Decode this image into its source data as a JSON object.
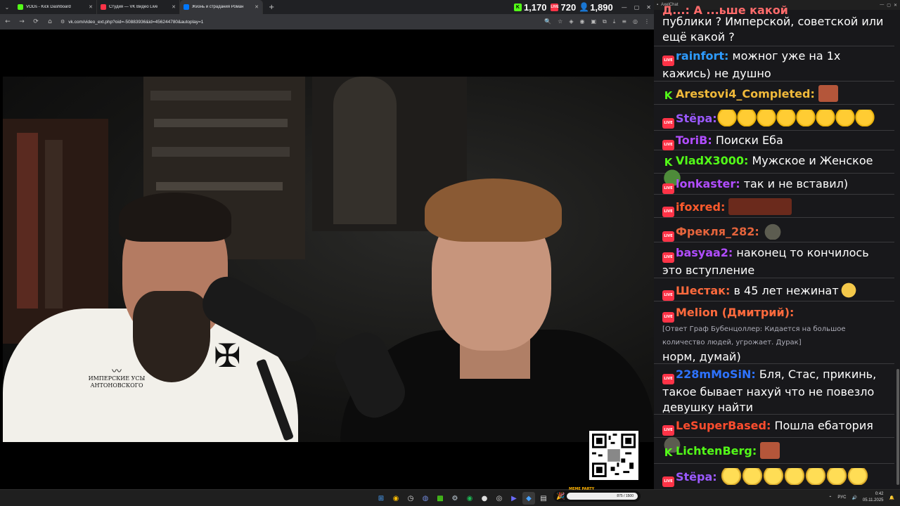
{
  "browser": {
    "tabs": [
      {
        "label": "VODs - Kick Dashboard",
        "favicon": "kick-icon"
      },
      {
        "label": "Студия — VK Видео Live",
        "favicon": "vk-live-icon"
      },
      {
        "label": "Жизнь и страдания Роман",
        "favicon": "vk-icon",
        "active": true
      }
    ],
    "url": "vk.com/video_ext.php?oid=-50883936&id=456244780&autoplay=1"
  },
  "counters": [
    {
      "platform": "kick",
      "value": "1,170",
      "color": "#53fc18"
    },
    {
      "platform": "vk-live",
      "value": "720",
      "color": "#ff3347"
    },
    {
      "platform": "viewers",
      "value": "1,890",
      "color": "#4aa3ff"
    }
  ],
  "video": {
    "shirt_logo_line1": "ИМПЕРСКИЕ УСЫ",
    "shirt_logo_line2": "АНТОНОВСКОГО"
  },
  "chat": {
    "window_title": "AxelChat",
    "messages": [
      {
        "platform": "live",
        "user": "",
        "color": "#ff6b6b",
        "text": "публики ? Имперской, советской или ещё какой ?"
      },
      {
        "platform": "live",
        "user": "rainfort:",
        "color": "#2e9cff",
        "text": "можног уже на 1х кажись) не душно"
      },
      {
        "platform": "kick",
        "user": "Arestovi4_Completed:",
        "color": "#f0b93a",
        "text": ""
      },
      {
        "platform": "live",
        "user": "Stёра:",
        "color": "#9b59ff",
        "text": ""
      },
      {
        "platform": "live",
        "user": "ToriB:",
        "color": "#b14dff",
        "text": "Поиски Еба"
      },
      {
        "platform": "kick",
        "user": "VladX3000:",
        "color": "#53fc18",
        "text": "Мужское и Женское"
      },
      {
        "platform": "live",
        "user": "lonkaster:",
        "color": "#b14dff",
        "text": "так и не вставил)"
      },
      {
        "platform": "live",
        "user": "ifoxred:",
        "color": "#ff5a2c",
        "text": ""
      },
      {
        "platform": "live",
        "user": "Фрекля_282:",
        "color": "#e5643c",
        "text": ""
      },
      {
        "platform": "live",
        "user": "basyaa2:",
        "color": "#b14dff",
        "text": "наконец то кончилось это вступление"
      },
      {
        "platform": "live",
        "user": "Шестак:",
        "color": "#ff6a3d",
        "text": "в 45 лет нежинат"
      },
      {
        "platform": "live",
        "user": "Melion (Дмитрий):",
        "color": "#ff6a3d",
        "reply": "[Ответ Граф Бубенцоллер: Кидается на большое количество людей, угрожает. Дурак]",
        "text": "норм, думай)"
      },
      {
        "platform": "live",
        "user": "228mMoSiN:",
        "color": "#2e73ff",
        "text": "Бля, Стас, прикинь, такое бывает нахуй что не повезло девушку найти"
      },
      {
        "platform": "live",
        "user": "LeSuperBased:",
        "color": "#ff4d2e",
        "text": "Пошла ебатория"
      },
      {
        "platform": "kick",
        "user": "LichtenBerg:",
        "color": "#53fc18",
        "text": ""
      },
      {
        "platform": "live",
        "user": "Stёра:",
        "color": "#9b59ff",
        "text": ""
      }
    ],
    "top_partial": "Д...: А ...ьше какой"
  },
  "taskbar": {
    "widget_title": "MEME PARTY",
    "widget_progress": "875 / 1500",
    "lang": "РУС",
    "time": "0:42",
    "date": "05.11.2025"
  }
}
